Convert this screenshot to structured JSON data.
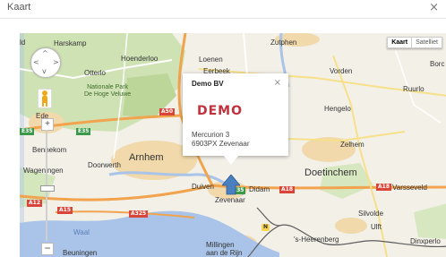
{
  "dialog": {
    "title": "Kaart",
    "close_symbol": "×"
  },
  "map_type": {
    "map": "Kaart",
    "satellite": "Satelliet"
  },
  "popup": {
    "title": "Demo BV",
    "close_symbol": "×",
    "logo_text": "DEMO",
    "address_line1": "Mercurion 3",
    "address_line2": "6903PX Zevenaar"
  },
  "zoom": {
    "plus": "+",
    "minus": "−"
  },
  "places": {
    "harskamp": "Harskamp",
    "hoenderloo": "Hoenderloo",
    "otterlo": "Otterlo",
    "park": "Nationale Park",
    "park2": "De Hoge Veluwe",
    "ede": "Ede",
    "bennekom": "Bennekom",
    "wageningen": "Wageningen",
    "doorwerth": "Doorwerth",
    "arnhem": "Arnhem",
    "zutphen": "Zutphen",
    "loenen": "Loenen",
    "eerbeek": "Eerbeek",
    "vorden": "Vorden",
    "borc": "Borc",
    "ruurlo": "Ruurlo",
    "hengelo": "Hengelo",
    "zelhem": "Zelhem",
    "doetinchem": "Doetinchem",
    "duiven": "Duiven",
    "didam": "Didam",
    "zevenaar": "Zevenaar",
    "varsseveld": "Varsseveld",
    "silvolde": "Silvolde",
    "ulft": "Ulft",
    "heerenberg": "'s-Heerenberg",
    "dinxperlo": "Dinxperlo",
    "millingen": "Millingen",
    "millingen2": "aan de Rijn",
    "beuningen": "Beuningen",
    "waal": "Waal",
    "ld": "ld"
  },
  "roads": {
    "a50": "A50",
    "e35a": "E35",
    "e35b": "E35",
    "a12": "A12",
    "a15": "A15",
    "a325": "A325",
    "a18": "A18",
    "a18b": "A18",
    "e35c": "E35",
    "n": "N"
  },
  "colors": {
    "urban": "#f2dbb0",
    "forest": "#c9dfae",
    "water": "#a9c4e8",
    "motorway": "#f1a34e",
    "border": "#5b5b5b",
    "marker": "#4a7fc0",
    "logo": "#c0313d"
  },
  "icons": [
    "pan-control-icon",
    "pegman-icon",
    "map-marker-icon",
    "close-icon"
  ]
}
